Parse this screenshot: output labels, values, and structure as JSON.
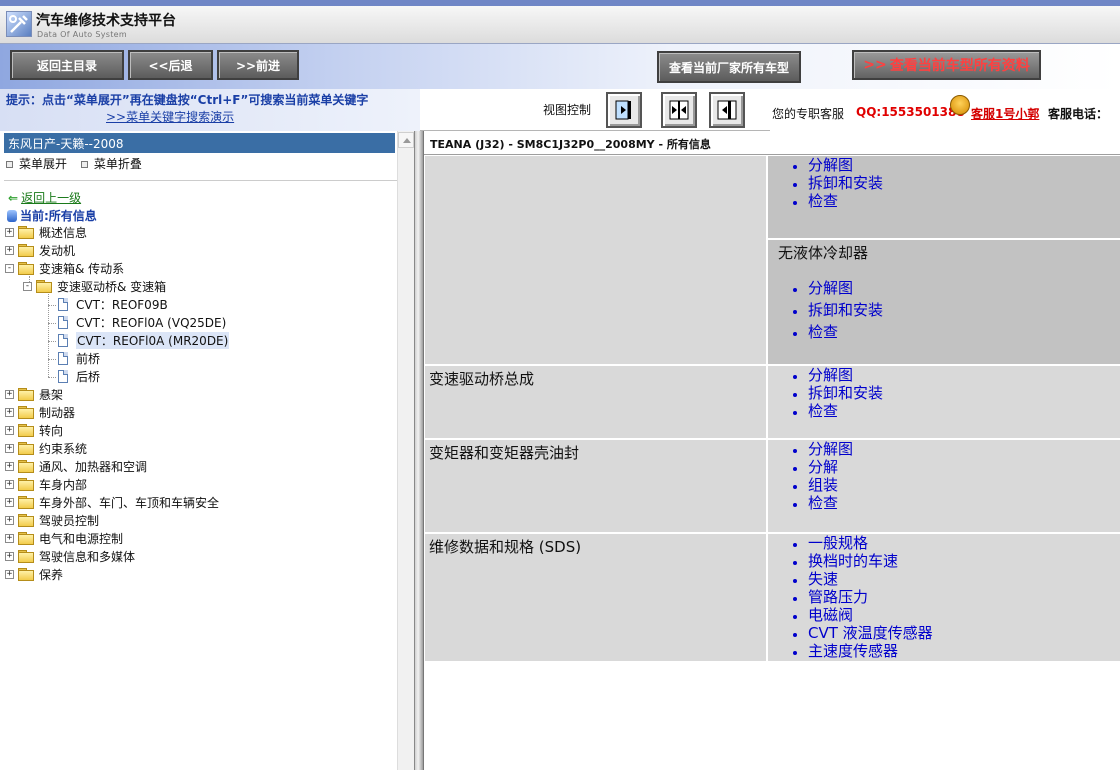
{
  "app": {
    "title": "汽车维修技术支持平台",
    "subtitle": "Data Of Auto System"
  },
  "toolbar": {
    "home_label": "返回主目录",
    "back_label": "<<后退",
    "forward_label": ">>前进",
    "maker_models_label": "查看当前厂家所有车型",
    "all_data_label": "查看当前车型所有资料",
    "all_data_arrow": ">>"
  },
  "hint": {
    "text": "提示：点击“菜单展开”再在键盘按“Ctrl+F”可搜索当前菜单关键字",
    "link": ">>菜单关键字搜索演示"
  },
  "view_control": {
    "label": "视图控制"
  },
  "service": {
    "label": "您的专职客服",
    "qq": "QQ:1553501388",
    "agent": "客服1号小郭",
    "phone_label": "客服电话："
  },
  "sidebar": {
    "vehicle": "东风日产-天籁--2008",
    "expand_label": "菜单展开",
    "collapse_label": "菜单折叠",
    "back_up_label": "返回上一级",
    "current_label": "当前:所有信息",
    "top_items": [
      {
        "label": "概述信息",
        "expander": "+"
      },
      {
        "label": "发动机",
        "expander": "+"
      },
      {
        "label": "变速箱& 传动系",
        "expander": "-"
      }
    ],
    "sub_folder": {
      "label": "变速驱动桥& 变速箱",
      "expander": "-"
    },
    "docs": [
      {
        "label": "CVT：REOF09B",
        "selected": false
      },
      {
        "label": "CVT：REOFl0A (VQ25DE)",
        "selected": false
      },
      {
        "label": "CVT：REOFl0A (MR20DE)",
        "selected": true
      },
      {
        "label": "前桥",
        "selected": false
      },
      {
        "label": "后桥",
        "selected": false
      }
    ],
    "bottom_items": [
      {
        "label": "悬架",
        "expander": "+"
      },
      {
        "label": "制动器",
        "expander": "+"
      },
      {
        "label": "转向",
        "expander": "+"
      },
      {
        "label": "约束系统",
        "expander": "+"
      },
      {
        "label": "通风、加热器和空调",
        "expander": "+"
      },
      {
        "label": "车身内部",
        "expander": "+"
      },
      {
        "label": "车身外部、车门、车顶和车辆安全",
        "expander": "+"
      },
      {
        "label": "驾驶员控制",
        "expander": "+"
      },
      {
        "label": "电气和电源控制",
        "expander": "+"
      },
      {
        "label": "驾驶信息和多媒体",
        "expander": "+"
      },
      {
        "label": "保养",
        "expander": "+"
      }
    ]
  },
  "content": {
    "title": "TEANA (J32) - SM8C1J32P0__2008MY - 所有信息",
    "row1_links": [
      "分解图",
      "拆卸和安装",
      "检查"
    ],
    "row2_heading": "无液体冷却器",
    "row2_links": [
      "分解图",
      "拆卸和安装",
      "检查"
    ],
    "row3": {
      "name": "变速驱动桥总成",
      "links": [
        "分解图",
        "拆卸和安装",
        "检查"
      ]
    },
    "row4": {
      "name": "变矩器和变矩器壳油封",
      "links": [
        "分解图",
        "分解",
        "组装",
        "检查"
      ]
    },
    "row5": {
      "name": "维修数据和规格 (SDS)",
      "links": [
        "一般规格",
        "换档时的车速",
        "失速",
        "管路压力",
        "电磁阀",
        "CVT 液温度传感器",
        "主速度传感器"
      ]
    }
  }
}
